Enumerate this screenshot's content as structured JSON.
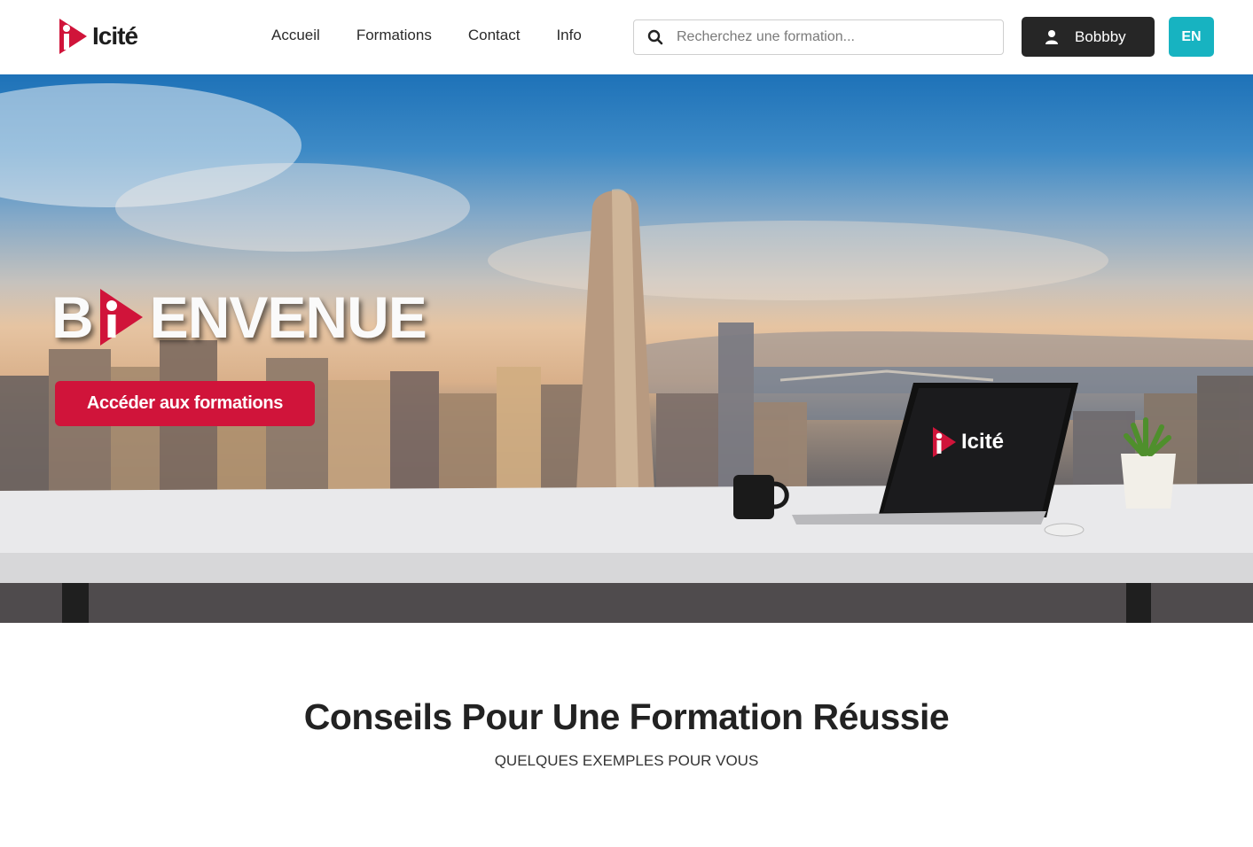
{
  "header": {
    "logo_text": "Icité",
    "nav": [
      "Accueil",
      "Formations",
      "Contact",
      "Info"
    ],
    "search_placeholder": "Recherchez une formation...",
    "user_name": "Bobbby",
    "lang": "EN"
  },
  "hero": {
    "welcome_before": "B",
    "welcome_after": "ENVENUE",
    "cta_label": "Accéder aux formations",
    "laptop_logo_text": "Icité"
  },
  "section": {
    "title": "Conseils Pour Une Formation Réussie",
    "subtitle": "QUELQUES EXEMPLES POUR VOUS"
  },
  "colors": {
    "brand_red": "#d0143a",
    "accent_teal": "#17b3c1",
    "dark": "#262626"
  }
}
